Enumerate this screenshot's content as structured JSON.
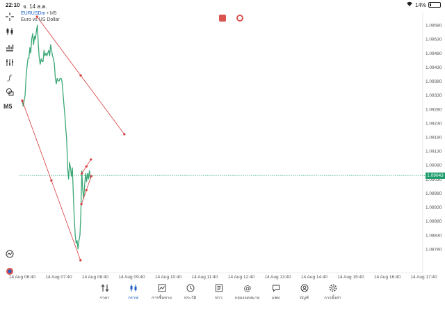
{
  "status_bar": {
    "time": "22:10",
    "date": "จ. 14 ส.ค.",
    "battery": "14%",
    "battery_level": 0.14
  },
  "symbol": {
    "ticker": "EURUSDm",
    "separator": "•",
    "timeframe": "M5",
    "description": "Euro vs US Dollar"
  },
  "left_tools": [
    "crosshair-icon",
    "candles-icon",
    "indicators-icon",
    "objects-icon",
    "function-icon",
    "shapes-icon"
  ],
  "timeframe_label": "M5",
  "colors": {
    "line": "#3aa776",
    "trendline": "#d63a3a",
    "price_line": "#23a06c",
    "active": "#1e62c8"
  },
  "bottom_nav": [
    {
      "label": "ราคา",
      "icon": "quotes-icon",
      "active": false
    },
    {
      "label": "กราฟ",
      "icon": "chart-icon",
      "active": true
    },
    {
      "label": "การซื้อขาย",
      "icon": "trade-icon",
      "active": false
    },
    {
      "label": "ประวัติ",
      "icon": "history-icon",
      "active": false
    },
    {
      "label": "ข่าว",
      "icon": "news-icon",
      "active": false
    },
    {
      "label": "กล่องจดหมาย",
      "icon": "mail-icon",
      "active": false
    },
    {
      "label": "แชท",
      "icon": "chat-icon",
      "active": false
    },
    {
      "label": "บัญชี",
      "icon": "account-icon",
      "active": false
    },
    {
      "label": "การตั้งค่า",
      "icon": "settings-icon",
      "active": false
    }
  ],
  "chart_data": {
    "type": "line",
    "title": "",
    "xlabel": "",
    "ylabel": "",
    "ylim": [
      1.0873,
      1.0962
    ],
    "y_ticks": [
      "1.09580",
      "1.09530",
      "1.09480",
      "1.09430",
      "1.09380",
      "1.09330",
      "1.09280",
      "1.09230",
      "1.09180",
      "1.09130",
      "1.09080",
      "1.09030",
      "1.08980",
      "1.08930",
      "1.08880",
      "1.08830",
      "1.08780"
    ],
    "x_ticks": [
      "14 Aug 06:40",
      "14 Aug 07:40",
      "14 Aug 08:40",
      "14 Aug 09:40",
      "14 Aug 10:40",
      "14 Aug 11:40",
      "14 Aug 12:40",
      "14 Aug 13:40",
      "14 Aug 14:40",
      "14 Aug 15:40",
      "14 Aug 16:40",
      "14 Aug 17:40"
    ],
    "current_price": "1.09043",
    "current_price_value": 1.09043,
    "series": [
      {
        "values": [
          [
            0,
            1.0931
          ],
          [
            0.5,
            1.0929
          ],
          [
            1,
            1.0931
          ],
          [
            1.5,
            1.0933
          ],
          [
            2,
            1.0939
          ],
          [
            2.5,
            1.0943
          ],
          [
            3,
            1.0946
          ],
          [
            3.5,
            1.0946
          ],
          [
            4,
            1.095
          ],
          [
            4.5,
            1.0948
          ],
          [
            5,
            1.0953
          ],
          [
            5.5,
            1.0955
          ],
          [
            6,
            1.0951
          ],
          [
            6.5,
            1.0954
          ],
          [
            7,
            1.0953
          ],
          [
            7.5,
            1.0956
          ],
          [
            8,
            1.0958
          ],
          [
            8.5,
            1.0951
          ],
          [
            9,
            1.0946
          ],
          [
            9.5,
            1.0944
          ],
          [
            10,
            1.0946
          ],
          [
            10.5,
            1.0945
          ],
          [
            11,
            1.0945
          ],
          [
            11.5,
            1.0949
          ],
          [
            12,
            1.0947
          ],
          [
            12.5,
            1.0948
          ],
          [
            13,
            1.0947
          ],
          [
            13.5,
            1.0948
          ],
          [
            14,
            1.0949
          ],
          [
            14.5,
            1.0947
          ],
          [
            15,
            1.0951
          ],
          [
            15.5,
            1.0949
          ],
          [
            16,
            1.0947
          ],
          [
            16.5,
            1.0946
          ],
          [
            17,
            1.0944
          ],
          [
            17.5,
            1.0939
          ],
          [
            18,
            1.0937
          ],
          [
            18.5,
            1.0939
          ],
          [
            19,
            1.0938
          ],
          [
            19.5,
            1.0938
          ],
          [
            20,
            1.0939
          ],
          [
            20.5,
            1.0939
          ],
          [
            21,
            1.0938
          ],
          [
            21.5,
            1.0934
          ],
          [
            22,
            1.093
          ],
          [
            22.5,
            1.0926
          ],
          [
            23,
            1.0921
          ],
          [
            23.5,
            1.0917
          ],
          [
            24,
            1.0907
          ],
          [
            24.5,
            1.0903
          ],
          [
            25,
            1.0909
          ],
          [
            25.5,
            1.0907
          ],
          [
            26,
            1.0904
          ],
          [
            26.5,
            1.0907
          ],
          [
            27,
            1.0898
          ],
          [
            27.5,
            1.0889
          ],
          [
            28,
            1.0883
          ],
          [
            28.5,
            1.088
          ],
          [
            29,
            1.0881
          ],
          [
            29.5,
            1.0878
          ],
          [
            30,
            1.0881
          ],
          [
            30.5,
            1.0883
          ],
          [
            31,
            1.0891
          ],
          [
            31.5,
            1.0906
          ],
          [
            32,
            1.0899
          ],
          [
            32.5,
            1.0896
          ],
          [
            33,
            1.0901
          ],
          [
            33.5,
            1.0905
          ],
          [
            34,
            1.0902
          ],
          [
            34.5,
            1.0905
          ],
          [
            35,
            1.0903
          ],
          [
            35.5,
            1.0906
          ],
          [
            36,
            1.0903
          ]
        ]
      }
    ],
    "trendlines": [
      {
        "from": [
          7.8,
          1.0961
        ],
        "to": [
          54.0,
          1.0919
        ]
      },
      {
        "from": [
          0.0,
          1.0931
        ],
        "to": [
          30.8,
          1.0874
        ]
      },
      {
        "from": [
          31.5,
          1.0905
        ],
        "to": [
          36.3,
          1.091
        ]
      },
      {
        "from": [
          31.3,
          1.0894
        ],
        "to": [
          36.5,
          1.0904
        ]
      }
    ]
  }
}
